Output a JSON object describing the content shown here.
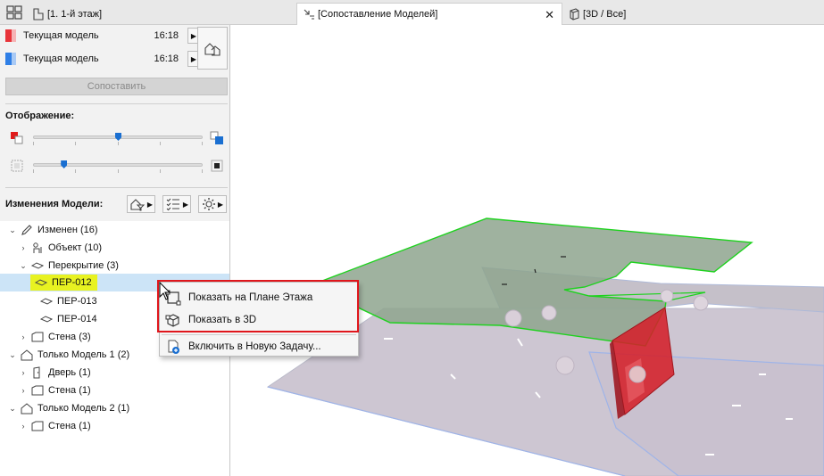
{
  "tabs": [
    {
      "label": "[1. 1-й этаж]"
    },
    {
      "label": "[Сопоставление Моделей]"
    },
    {
      "label": "[3D / Все]"
    }
  ],
  "models": [
    {
      "name": "Текущая модель",
      "time": "16:18",
      "color": "#e8343a"
    },
    {
      "name": "Текущая модель",
      "time": "16:18",
      "color": "#2f7fe6"
    }
  ],
  "compare_button": "Сопоставить",
  "display_label": "Отображение:",
  "display_sliders": [
    {
      "level": 0.5
    },
    {
      "level": 0.18
    }
  ],
  "changes_label": "Изменения Модели:",
  "tree": {
    "modified": "Изменен (16)",
    "object": "Объект (10)",
    "slab": "Перекрытие (3)",
    "slab_items": [
      "ПЕР-012",
      "ПЕР-013",
      "ПЕР-014"
    ],
    "wall": "Стена (3)",
    "only1": "Только Модель 1 (2)",
    "door": "Дверь (1)",
    "wall1": "Стена (1)",
    "only2": "Только Модель 2 (1)",
    "wall2": "Стена (1)"
  },
  "context_menu": {
    "show_plan": "Показать на Плане Этажа",
    "show_3d": "Показать в 3D",
    "include_task": "Включить в Новую Задачу..."
  },
  "colors": {
    "highlight_border": "#e0161c",
    "selection": "#cce4f7",
    "tree_highlight": "#e8f221",
    "accent": "#1a6fd1"
  }
}
